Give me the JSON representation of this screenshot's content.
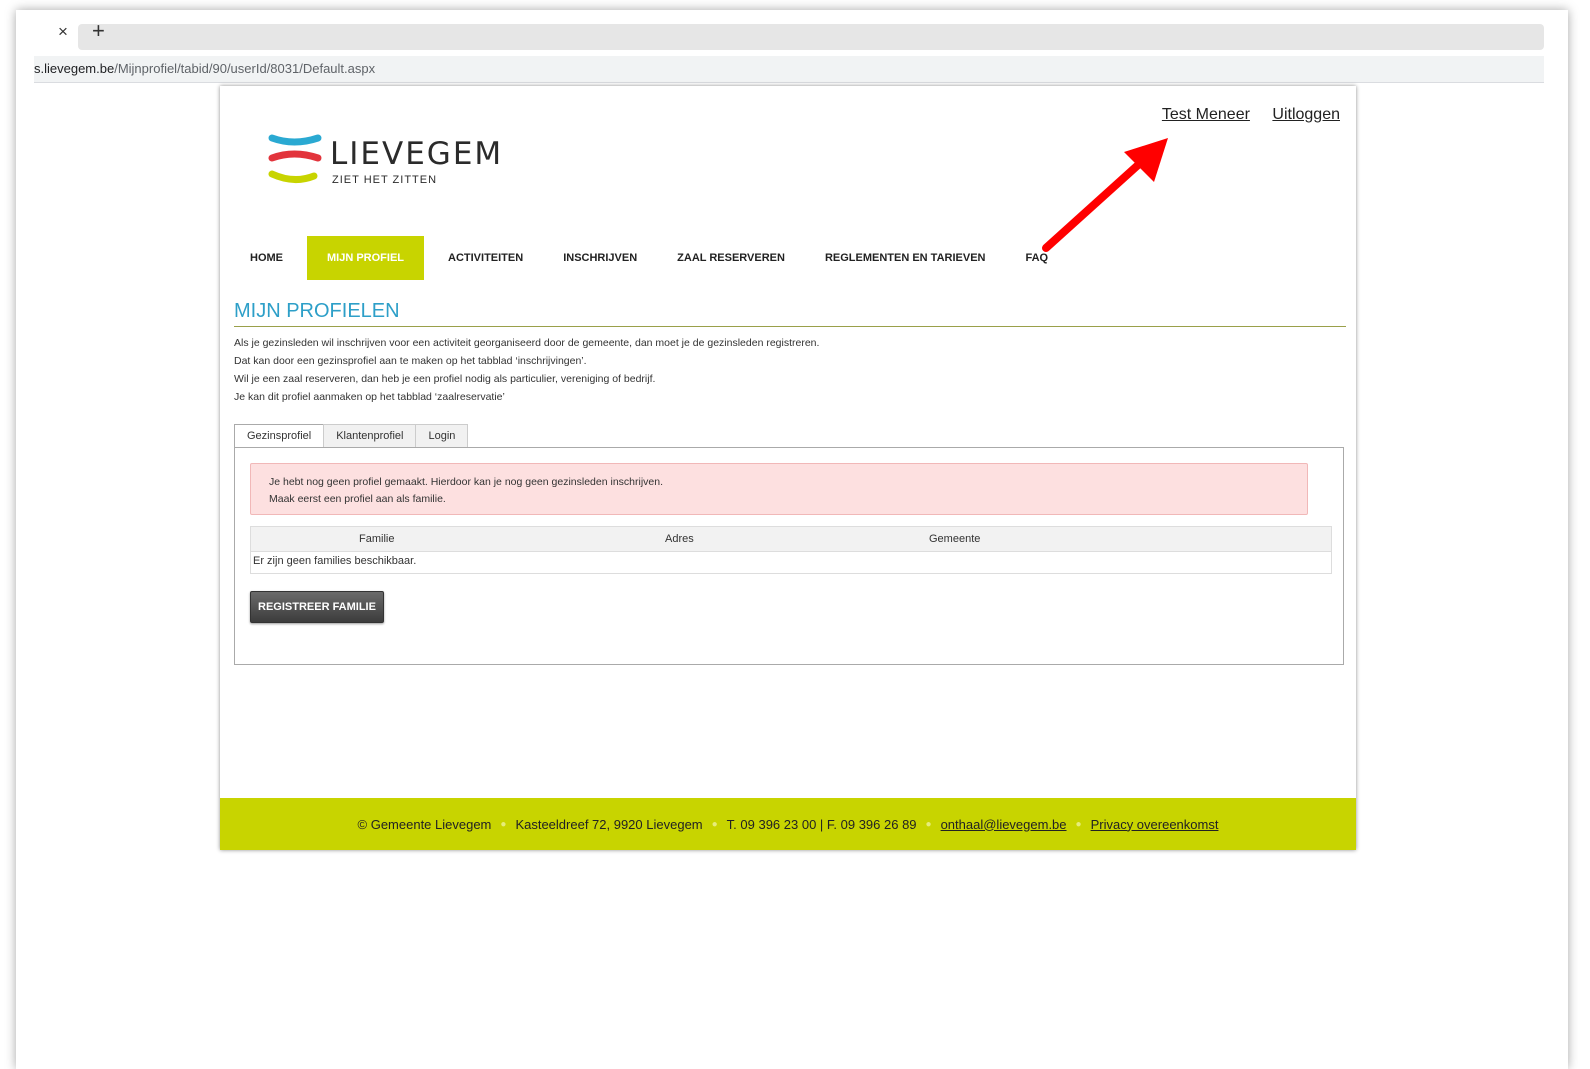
{
  "browser": {
    "tab_close": "×",
    "tab_new": "+",
    "url_host": "s.lievegem.be",
    "url_path": "/Mijnprofiel/tabid/90/userId/8031/Default.aspx"
  },
  "header": {
    "user_name": "Test Meneer",
    "logout": "Uitloggen"
  },
  "logo": {
    "wordmark": "LIEVEGEM",
    "tagline": "ZIET HET ZITTEN",
    "stripe_colors": [
      "#2aa9d2",
      "#e2343c",
      "#c8d400"
    ]
  },
  "nav": {
    "items": [
      {
        "label": "HOME"
      },
      {
        "label": "MIJN PROFIEL",
        "active": true
      },
      {
        "label": "ACTIVITEITEN"
      },
      {
        "label": "INSCHRIJVEN"
      },
      {
        "label": "ZAAL RESERVEREN"
      },
      {
        "label": "REGLEMENTEN EN TARIEVEN"
      },
      {
        "label": "FAQ"
      }
    ]
  },
  "main": {
    "title": "MIJN PROFIELEN",
    "intro": [
      "Als je gezinsleden wil inschrijven voor een activiteit georganiseerd door de gemeente, dan moet je de gezinsleden registreren.",
      "Dat kan door een gezinsprofiel aan te maken op het tabblad ‘inschrijvingen’.",
      "Wil je een zaal reserveren, dan heb je een profiel nodig als particulier, vereniging of bedrijf.",
      "Je kan dit profiel aanmaken op het tabblad ‘zaalreservatie’"
    ],
    "tabs": [
      {
        "label": "Gezinsprofiel",
        "active": true
      },
      {
        "label": "Klantenprofiel"
      },
      {
        "label": "Login"
      }
    ],
    "alert": [
      "Je hebt nog geen profiel gemaakt. Hierdoor kan je nog geen gezinsleden inschrijven.",
      "Maak eerst een profiel aan als familie."
    ],
    "grid": {
      "columns": [
        "Familie",
        "Adres",
        "Gemeente"
      ],
      "empty_text": "Er zijn geen families beschikbaar."
    },
    "register_button": "REGISTREER FAMILIE"
  },
  "footer": {
    "copyright": "© Gemeente Lievegem",
    "address": "Kasteeldreef 72, 9920 Lievegem",
    "phone": "T. 09 396 23 00 | F. 09 396 26 89",
    "email": "onthaal@lievegem.be",
    "privacy": "Privacy overeenkomst"
  },
  "annotation": {
    "arrow_color": "#ff0000"
  }
}
